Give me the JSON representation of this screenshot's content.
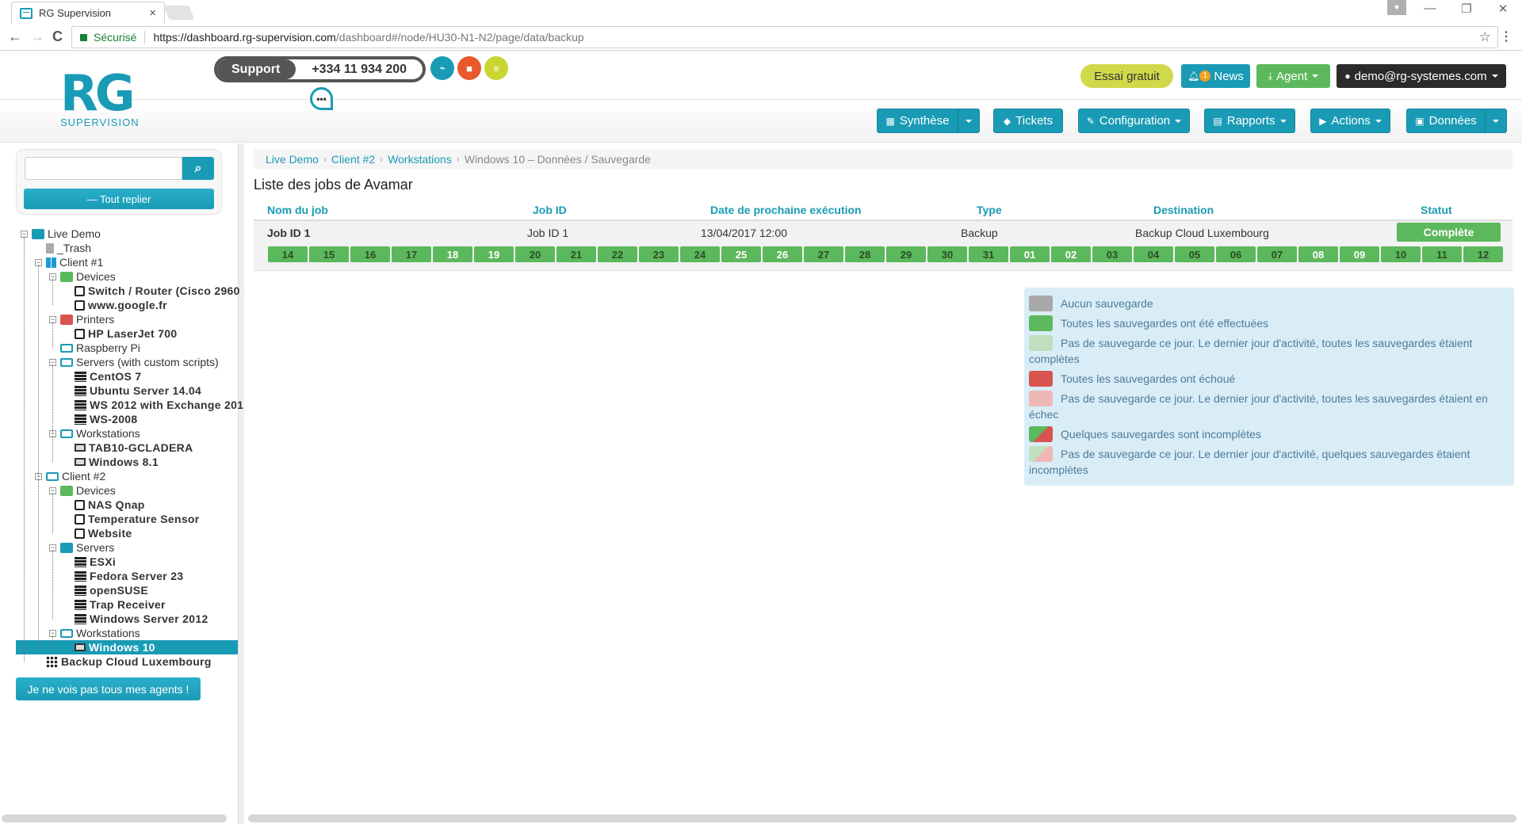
{
  "browser": {
    "tab_title": "RG Supervision",
    "tab_close": "×",
    "secure_label": "Sécurisé",
    "url_host": "https://dashboard.rg-supervision.com",
    "url_path": "/dashboard#/node/HU30-N1-N2/page/data/backup",
    "back": "←",
    "forward": "→",
    "reload": "C",
    "star": "☆",
    "menu": "⋮",
    "minimize": "—",
    "maximize": "❐",
    "close": "✕"
  },
  "header": {
    "logo_main": "RG",
    "logo_sub": "SUPERVISION",
    "support_label": "Support",
    "support_phone": "+334 11 934 200",
    "chat_icon": "•••",
    "trial_label": "Essai gratuit",
    "news_label": "News",
    "news_count": "1",
    "agent_label": "Agent",
    "user_label": "demo@rg-systemes.com",
    "circle_icons": [
      {
        "name": "monitor-icon",
        "color": "#1a9bb5",
        "glyph": "⌁"
      },
      {
        "name": "shield-lock-icon",
        "color": "#e8592b",
        "glyph": "🔒"
      },
      {
        "name": "database-icon",
        "color": "#c9d531",
        "glyph": "≡"
      }
    ]
  },
  "nav": {
    "buttons": [
      {
        "label": "Synthèse",
        "icon": "▦"
      },
      {
        "label": "Tickets",
        "icon": "◆"
      },
      {
        "label": "Configuration",
        "icon": "✎"
      },
      {
        "label": "Rapports",
        "icon": "▤"
      },
      {
        "label": "Actions",
        "icon": "▶"
      },
      {
        "label": "Données",
        "icon": "▣"
      }
    ]
  },
  "sidebar": {
    "search_placeholder": "",
    "search_icon": "⌕",
    "collapse_label": "— Tout replier",
    "agents_button": "Je ne vois pas tous mes agents !",
    "tree": [
      {
        "label": "Live Demo",
        "level": 0,
        "icon": "folder-filled",
        "expand": true
      },
      {
        "label": "_Trash",
        "level": 1,
        "icon": "trash"
      },
      {
        "label": "Client #1",
        "level": 1,
        "icon": "windows",
        "expand": true
      },
      {
        "label": "Devices",
        "level": 2,
        "icon": "folder-green",
        "expand": true
      },
      {
        "label": "Switch / Router (Cisco 2960",
        "level": 3,
        "icon": "device",
        "bold": true
      },
      {
        "label": "www.google.fr",
        "level": 3,
        "icon": "device",
        "bold": true
      },
      {
        "label": "Printers",
        "level": 2,
        "icon": "folder-red",
        "expand": true
      },
      {
        "label": "HP LaserJet 700",
        "level": 3,
        "icon": "device",
        "bold": true
      },
      {
        "label": "Raspberry Pi",
        "level": 2,
        "icon": "folder-outline"
      },
      {
        "label": "Servers (with custom scripts)",
        "level": 2,
        "icon": "folder-outline",
        "expand": true
      },
      {
        "label": "CentOS 7",
        "level": 3,
        "icon": "server",
        "bold": true
      },
      {
        "label": "Ubuntu Server 14.04",
        "level": 3,
        "icon": "server",
        "bold": true
      },
      {
        "label": "WS 2012 with Exchange 201",
        "level": 3,
        "icon": "server",
        "bold": true
      },
      {
        "label": "WS-2008",
        "level": 3,
        "icon": "server",
        "bold": true
      },
      {
        "label": "Workstations",
        "level": 2,
        "icon": "folder-outline",
        "expand": true
      },
      {
        "label": "TAB10-GCLADERA",
        "level": 3,
        "icon": "workstation",
        "bold": true
      },
      {
        "label": "Windows 8.1",
        "level": 3,
        "icon": "workstation",
        "bold": true
      },
      {
        "label": "Client #2",
        "level": 1,
        "icon": "folder-outline",
        "expand": true
      },
      {
        "label": "Devices",
        "level": 2,
        "icon": "folder-green",
        "expand": true
      },
      {
        "label": "NAS Qnap",
        "level": 3,
        "icon": "device",
        "bold": true
      },
      {
        "label": "Temperature Sensor",
        "level": 3,
        "icon": "device",
        "bold": true
      },
      {
        "label": "Website",
        "level": 3,
        "icon": "device",
        "bold": true
      },
      {
        "label": "Servers",
        "level": 2,
        "icon": "folder-filled",
        "expand": true
      },
      {
        "label": "ESXi",
        "level": 3,
        "icon": "server",
        "bold": true
      },
      {
        "label": "Fedora Server 23",
        "level": 3,
        "icon": "server",
        "bold": true
      },
      {
        "label": "openSUSE",
        "level": 3,
        "icon": "server",
        "bold": true
      },
      {
        "label": "Trap Receiver",
        "level": 3,
        "icon": "server",
        "bold": true
      },
      {
        "label": "Windows Server 2012",
        "level": 3,
        "icon": "server",
        "bold": true
      },
      {
        "label": "Workstations",
        "level": 2,
        "icon": "folder-outline",
        "expand": true
      },
      {
        "label": "Windows 10",
        "level": 3,
        "icon": "workstation",
        "bold": true,
        "selected": true
      },
      {
        "label": "Backup Cloud Luxembourg",
        "level": 1,
        "icon": "grid",
        "bold": true
      }
    ]
  },
  "main": {
    "breadcrumb": {
      "links": [
        "Live Demo",
        "Client #2",
        "Workstations"
      ],
      "current": "Windows 10 – Données / Sauvegarde",
      "separator": "›"
    },
    "title": "Liste des jobs de Avamar",
    "columns": [
      "Nom du job",
      "Job ID",
      "Date de prochaine exécution",
      "Type",
      "Destination",
      "Statut"
    ],
    "jobs": [
      {
        "name": "Job ID 1",
        "job_id": "Job ID 1",
        "next_run": "13/04/2017 12:00",
        "type": "Backup",
        "destination": "Backup Cloud Luxembourg",
        "status": "Complète",
        "days": [
          {
            "d": "14",
            "weekend": false
          },
          {
            "d": "15",
            "weekend": false
          },
          {
            "d": "16",
            "weekend": false
          },
          {
            "d": "17",
            "weekend": false
          },
          {
            "d": "18",
            "weekend": true
          },
          {
            "d": "19",
            "weekend": true
          },
          {
            "d": "20",
            "weekend": false
          },
          {
            "d": "21",
            "weekend": false
          },
          {
            "d": "22",
            "weekend": false
          },
          {
            "d": "23",
            "weekend": false
          },
          {
            "d": "24",
            "weekend": false
          },
          {
            "d": "25",
            "weekend": true
          },
          {
            "d": "26",
            "weekend": true
          },
          {
            "d": "27",
            "weekend": false
          },
          {
            "d": "28",
            "weekend": false
          },
          {
            "d": "29",
            "weekend": false
          },
          {
            "d": "30",
            "weekend": false
          },
          {
            "d": "31",
            "weekend": false
          },
          {
            "d": "01",
            "weekend": true
          },
          {
            "d": "02",
            "weekend": true
          },
          {
            "d": "03",
            "weekend": false
          },
          {
            "d": "04",
            "weekend": false
          },
          {
            "d": "05",
            "weekend": false
          },
          {
            "d": "06",
            "weekend": false
          },
          {
            "d": "07",
            "weekend": false
          },
          {
            "d": "08",
            "weekend": true
          },
          {
            "d": "09",
            "weekend": true
          },
          {
            "d": "10",
            "weekend": false
          },
          {
            "d": "11",
            "weekend": false
          },
          {
            "d": "12",
            "weekend": false
          }
        ]
      }
    ],
    "legend": [
      {
        "label": "Aucun sauvegarde",
        "swatch": "#a8a8a8"
      },
      {
        "label": "Toutes les sauvegardes ont été effectuées",
        "swatch": "#5cb85c"
      },
      {
        "label": "Pas de sauvegarde ce jour. Le dernier jour d'activité, toutes les sauvegardes étaient complètes",
        "swatch": "#bfe0bf"
      },
      {
        "label": "Toutes les sauvegardes ont échoué",
        "swatch": "#d9534f"
      },
      {
        "label": "Pas de sauvegarde ce jour. Le dernier jour d'activité, toutes les sauvegardes étaient en échec",
        "swatch": "#efb8b7"
      },
      {
        "label": "Quelques sauvegardes sont incomplètes",
        "swatch": "linear-gradient(135deg,#5cb85c 50%,#d9534f 50%)"
      },
      {
        "label": "Pas de sauvegarde ce jour. Le dernier jour d'activité, quelques sauvegardes étaient incomplètes",
        "swatch": "linear-gradient(135deg,#bfe0bf 50%,#efb8b7 50%)"
      }
    ]
  },
  "colors": {
    "accent": "#1a9bb5",
    "success": "#5cb85c",
    "danger": "#d9534f",
    "trial": "#cfd94a",
    "dark": "#2b2b2b"
  }
}
